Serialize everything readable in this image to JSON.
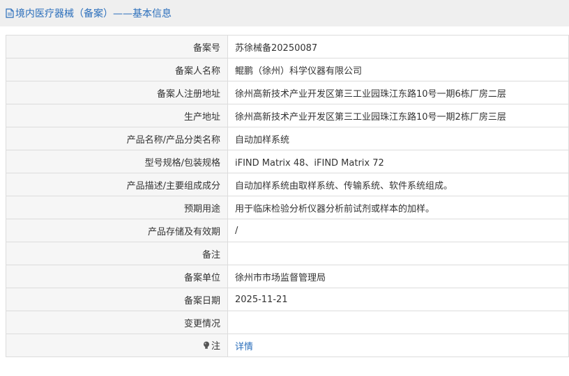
{
  "header": {
    "title": "境内医疗器械（备案）——基本信息"
  },
  "rows": [
    {
      "label": "备案号",
      "value": "苏徐械备20250087"
    },
    {
      "label": "备案人名称",
      "value": "鲲鹏（徐州）科学仪器有限公司"
    },
    {
      "label": "备案人注册地址",
      "value": "徐州高新技术产业开发区第三工业园珠江东路10号一期6栋厂房二层"
    },
    {
      "label": "生产地址",
      "value": "徐州高新技术产业开发区第三工业园珠江东路10号一期2栋厂房三层"
    },
    {
      "label": "产品名称/产品分类名称",
      "value": "自动加样系统"
    },
    {
      "label": "型号规格/包装规格",
      "value": "iFIND Matrix 48、iFIND Matrix 72"
    },
    {
      "label": "产品描述/主要组成成分",
      "value": "自动加样系统由取样系统、传输系统、软件系统组成。"
    },
    {
      "label": "预期用途",
      "value": "用于临床检验分析仪器分析前试剂或样本的加样。"
    },
    {
      "label": "产品存储及有效期",
      "value": "/"
    },
    {
      "label": "备注",
      "value": ""
    },
    {
      "label": "备案单位",
      "value": "徐州市市场监督管理局"
    },
    {
      "label": "备案日期",
      "value": "2025-11-21"
    },
    {
      "label": "变更情况",
      "value": ""
    }
  ],
  "note_row": {
    "label": "注",
    "link": "详情",
    "icon": "bulb-icon"
  },
  "colors": {
    "link": "#2a6ebb",
    "header_bg": "#efefef",
    "label_bg": "#f6f6f6",
    "border": "#dcdcdc"
  }
}
